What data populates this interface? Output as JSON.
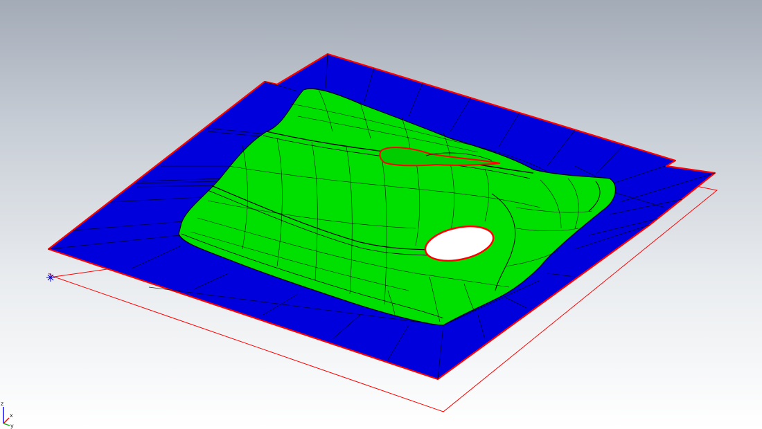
{
  "viewport": {
    "background_top": "#a3abb7",
    "background_bottom": "#ffffff"
  },
  "model": {
    "binder_color": "#0000dd",
    "part_color": "#00e000",
    "edge_color": "#ff0000",
    "wire_color": "#000000",
    "hole_fill": "#ffffff"
  },
  "triad": {
    "axes": [
      "z",
      "x",
      "y"
    ],
    "x_color": "#ff0000",
    "y_color": "#00aa00",
    "z_color": "#0000ff"
  }
}
